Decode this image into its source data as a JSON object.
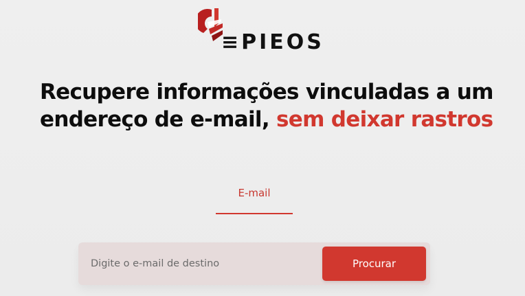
{
  "logo": {
    "text": "≡PIEOS"
  },
  "headline": {
    "line1": "Recupere informações vinculadas a um",
    "line2_part1": "endereço de e-mail,",
    "line2_accent": "sem deixar rastros"
  },
  "tabs": [
    {
      "label": "E-mail",
      "active": true
    }
  ],
  "search": {
    "value": "",
    "placeholder": "Digite o e-mail de destino",
    "button_label": "Procurar"
  },
  "colors": {
    "accent": "#d1382f",
    "background": "#ececec",
    "text": "#0d0d0d",
    "input_bg": "#e6dbdb"
  }
}
